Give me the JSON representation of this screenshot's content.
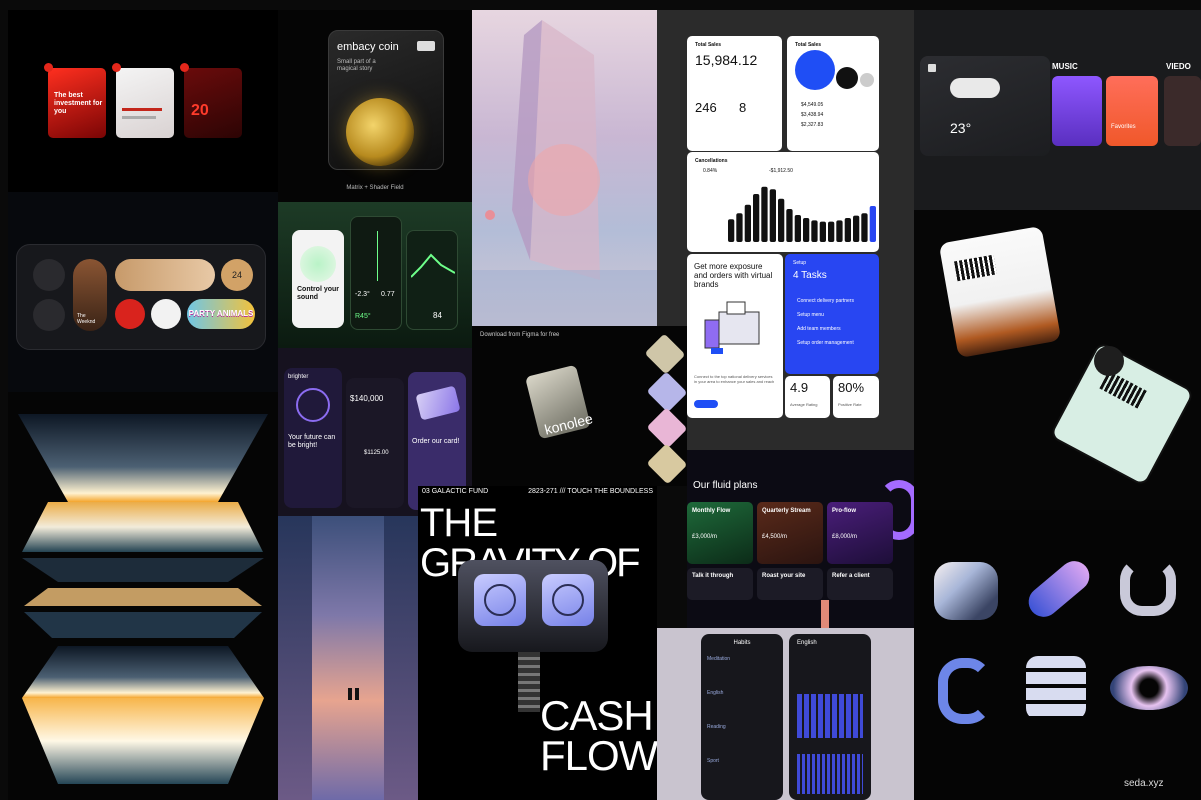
{
  "tiles": {
    "red_decks": {
      "cards": [
        "The best investment for you",
        "20"
      ]
    },
    "coin": {
      "brand": "embacy coin",
      "tagline": "Small part of a magical story",
      "caption": "Matrix + Shader Field"
    },
    "dashboard": {
      "total_sales_label": "Total Sales",
      "total_sales_value": "15,984.12",
      "small_values": [
        "246",
        "8"
      ],
      "legend_values": [
        "$4,549.05",
        "$3,438.94",
        "$2,327.83"
      ],
      "cancellations_label": "Cancellations",
      "cancellations_stats": [
        "0.84%",
        "-$1,912.50"
      ],
      "bar_heights": [
        0.38,
        0.48,
        0.62,
        0.8,
        0.92,
        0.88,
        0.72,
        0.55,
        0.45,
        0.4,
        0.36,
        0.34,
        0.34,
        0.36,
        0.4,
        0.44,
        0.48,
        0.6
      ],
      "promo_title": "Get more exposure and orders with virtual brands",
      "promo_body": "Connect to the top national delivery services in your area to enhance your sales and reach",
      "setup_label": "Setup",
      "tasks_title": "4 Tasks",
      "task_items": [
        "Connect delivery partners",
        "Setup menu",
        "Add team members",
        "Setup order management"
      ],
      "rating": "4.9",
      "percent": "80%",
      "rating_caption": "Average Rating",
      "percent_caption": "Positive Rate"
    },
    "music": {
      "temp": "23°",
      "section_music": "MUSIC",
      "section_video": "VIEDO",
      "track": "Favorites"
    },
    "phone_widgets": {
      "artist": "The Weeknd",
      "game": "PARTY ANIMALS",
      "day": "24"
    },
    "sound": {
      "title": "Control your sound",
      "values": [
        "-2.3°",
        "0.77",
        "R45°",
        "84"
      ]
    },
    "brighter": {
      "brand": "brighter",
      "headline": "Your future can be bright!",
      "balance": "$140,000",
      "amount": "$1125.00",
      "cta": "Order our card!"
    },
    "konolee": {
      "download_note": "Download from Figma for free",
      "brand": "konolee"
    },
    "gravity": {
      "meta_left": "03   GALACTIC FUND",
      "meta_right": "2823-271 /// TOUCH THE BOUNDLESS",
      "title_1": "THE",
      "title_2": "GRAVITY OF",
      "title_3": "CASH",
      "title_4": "FLOW"
    },
    "plans": {
      "title": "Our fluid plans",
      "cards": [
        {
          "name": "Monthly Flow",
          "price": "£3,000/m"
        },
        {
          "name": "Quarterly Stream",
          "price": "£4,500/m"
        },
        {
          "name": "Pro-flow",
          "price": "£8,000/m"
        }
      ],
      "bottom_cards": [
        "Talk it through",
        "Roast your site",
        "Refer a client"
      ]
    },
    "habits": {
      "title": "Habits",
      "rows": [
        "Meditation",
        "English",
        "Reading",
        "Sport"
      ],
      "second_title": "English"
    },
    "shapes": {
      "site": "seda.xyz"
    }
  }
}
